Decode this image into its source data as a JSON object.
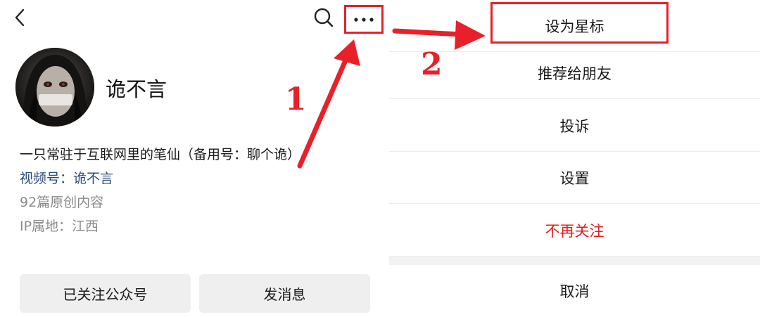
{
  "profile": {
    "name": "诡不言",
    "bio": "一只常驻于互联网里的笔仙（备用号：聊个诡）",
    "channel_label": "视频号：",
    "channel_name": "诡不言",
    "original_count": "92篇原创内容",
    "ip_location": "IP属地：江西"
  },
  "actions": {
    "followed_label": "已关注公众号",
    "message_label": "发消息"
  },
  "menu": {
    "items": [
      {
        "label": "设为星标"
      },
      {
        "label": "推荐给朋友"
      },
      {
        "label": "投诉"
      },
      {
        "label": "设置"
      },
      {
        "label": "不再关注"
      }
    ],
    "cancel_label": "取消"
  },
  "annotations": {
    "step1": "1",
    "step2": "2",
    "color": "#e8202a"
  },
  "colors": {
    "danger": "#e02020",
    "link": "#2b4b7d",
    "secondary_text": "#8a8a8a",
    "button_bg": "#efefef"
  },
  "icons": [
    "back-icon",
    "search-icon",
    "more-icon"
  ]
}
